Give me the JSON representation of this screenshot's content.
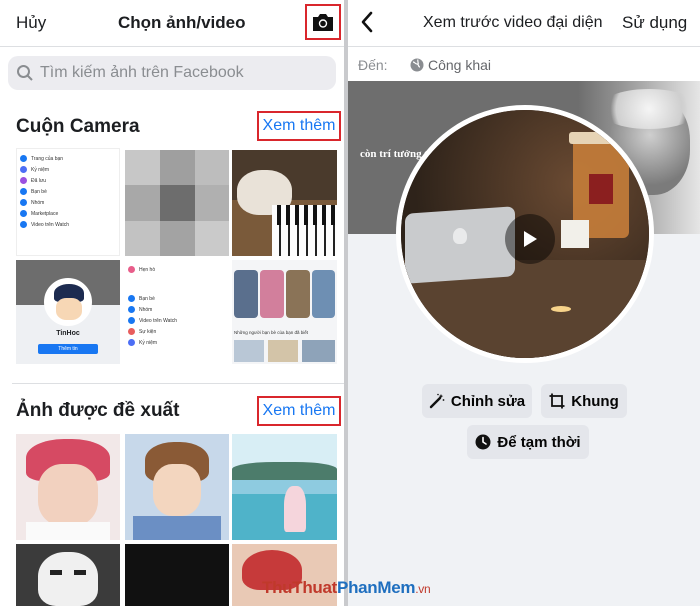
{
  "left": {
    "cancel": "Hủy",
    "title": "Chọn ảnh/video",
    "camera_icon": "camera-icon",
    "search_placeholder": "Tìm kiếm ảnh trên Facebook",
    "camera_roll": {
      "title": "Cuộn Camera",
      "see_more": "Xem thêm"
    },
    "suggested": {
      "title": "Ảnh được đề xuất",
      "see_more": "Xem thêm"
    },
    "mini_menu_1": [
      "Trang của bạn",
      "Kỷ niệm",
      "Đã lưu",
      "Bạn bè",
      "Nhóm",
      "Marketplace",
      "Video trên Watch"
    ],
    "mini_menu_2": [
      "Hẹn hò",
      "Bạn bè",
      "Nhóm",
      "Video trên Watch",
      "Sự kiện",
      "Kỷ niệm"
    ],
    "profile_name": "TinHoc",
    "profile_button": "Thêm tin",
    "mini_news_label": "Những người bạn bè của bạn đã biết"
  },
  "right": {
    "title": "Xem trước video đại diện",
    "use": "Sử dụng",
    "to_label": "Đến:",
    "audience": "Công khai",
    "cover_text": "còn trí tưởng t",
    "edit": "Chỉnh sửa",
    "frame": "Khung",
    "temporary": "Để tạm thời"
  },
  "watermark": {
    "part1": "ThuThuat",
    "part2": "PhanMem",
    "part3": ".vn"
  },
  "colors": {
    "accent": "#1877f2",
    "highlight_box": "#d9262c",
    "button_bg": "#e4e6eb"
  }
}
